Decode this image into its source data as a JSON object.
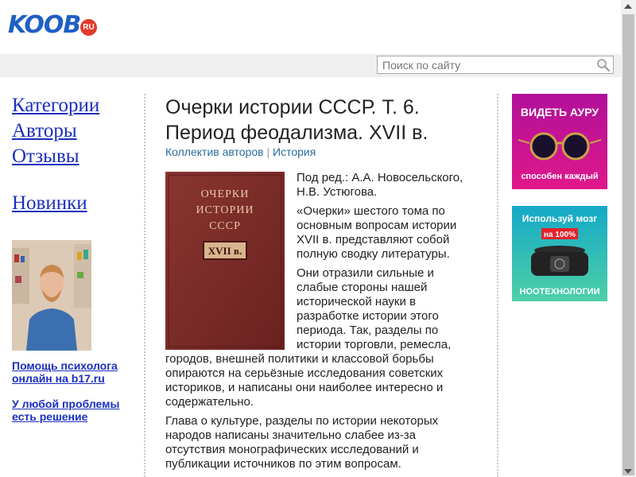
{
  "header": {
    "logo": "KOOB",
    "logo_badge": "RU"
  },
  "search": {
    "placeholder": "Поиск по сайту"
  },
  "nav": {
    "items": [
      "Категории",
      "Авторы",
      "Отзывы",
      "Новинки"
    ]
  },
  "sidebar_ads": {
    "link1": [
      "Помощь психолога",
      "онлайн на b17.ru"
    ],
    "link2": [
      "У любой проблемы",
      "есть решение"
    ]
  },
  "book": {
    "title": "Очерки истории СССР. Т. 6. Период феодализма. XVII в.",
    "author": "Коллектив авторов",
    "separator": "|",
    "category": "История",
    "cover": {
      "line1": "ОЧЕРКИ",
      "line2": "ИСТОРИИ",
      "line3": "СССР",
      "label": "XVII в."
    },
    "paragraphs": [
      "Под ред.: А.А. Новосельского, Н.В. Устюгова.",
      "«Очерки» шестого тома по основным вопросам истории XVII в. представляют собой полную сводку литературы.",
      "Они отразили сильные и слабые стороны нашей исторической науки в разработке истории этого периода. Так, разделы по истории торговли, ремесла, городов, внешней политики и классовой борьбы опираются на серьёзные исследования советских историков, и написаны они наиболее интересно и содержательно.",
      "Глава о культуре, разделы по истории некоторых народов написаны значительно слабее из-за отсутствия монографических исследований и публикации источников по этим вопросам."
    ]
  },
  "right_ads": [
    {
      "title": "ВИДЕТЬ АУРУ",
      "subtitle": "способен каждый"
    },
    {
      "title": "Используй мозг",
      "badge": "на 100%",
      "subtitle": "НООТЕХНОЛОГИИ"
    }
  ],
  "colors": {
    "logo": "#1e5fc4",
    "link": "#1a2fc0",
    "meta": "#2a6d9c",
    "badge": "#e23a2d",
    "cover": "#7a2a26"
  }
}
